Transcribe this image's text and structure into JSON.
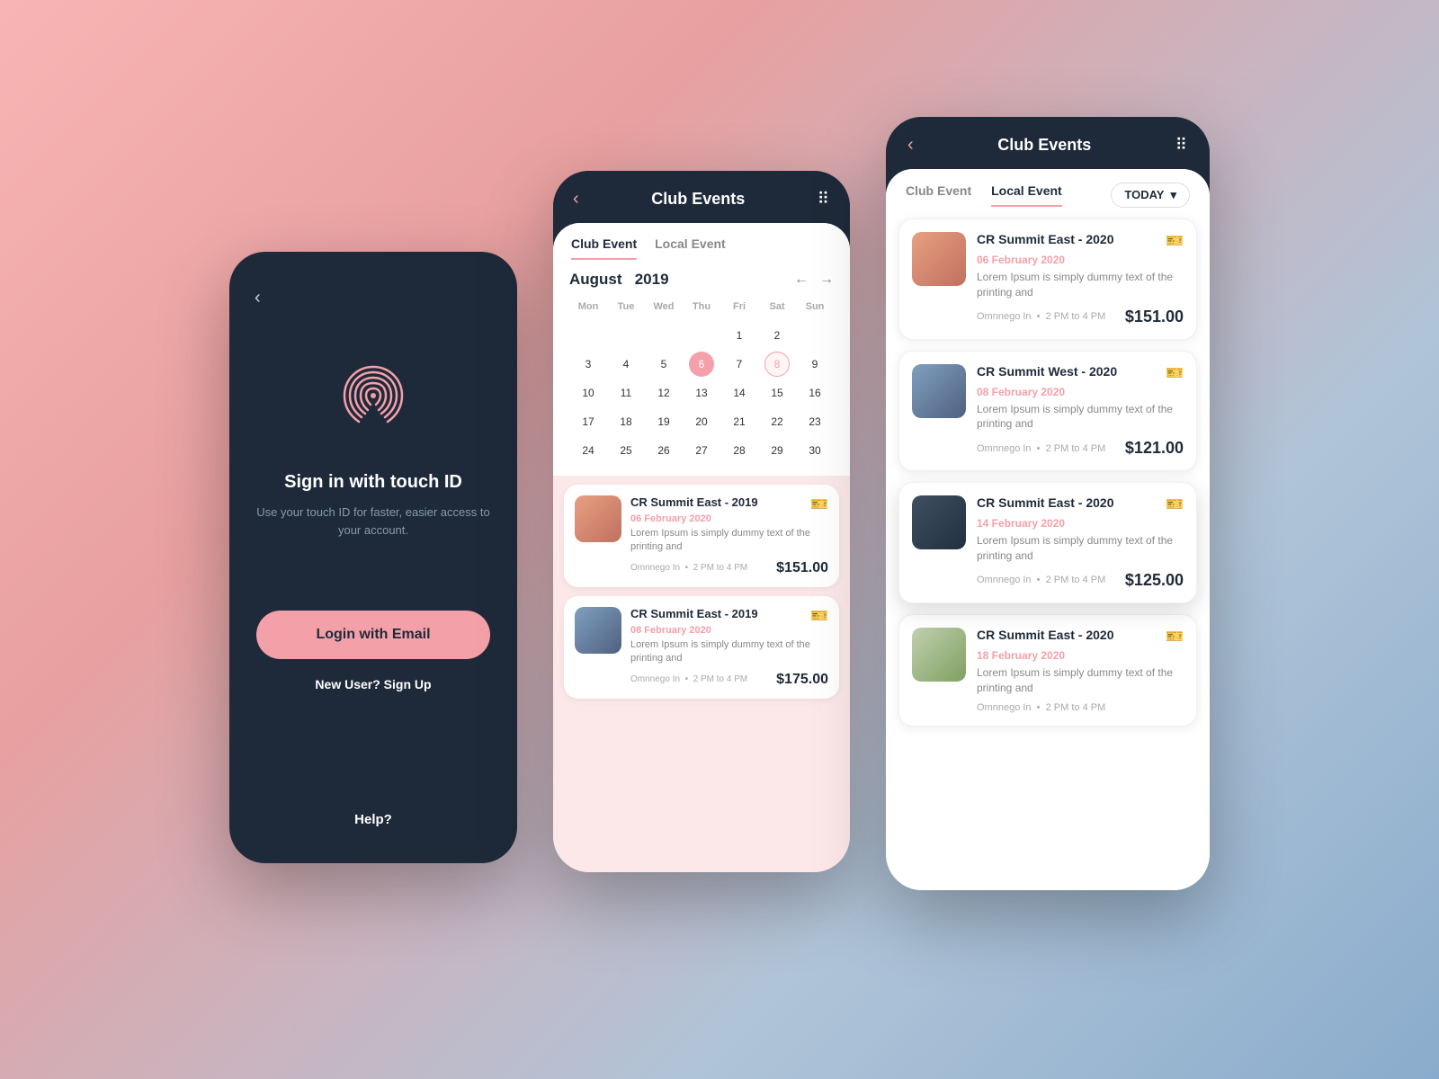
{
  "background": {
    "gradient_start": "#f8b4b4",
    "gradient_end": "#8aaccc"
  },
  "phone1": {
    "back_arrow": "‹",
    "fingerprint_label": "fingerprint",
    "title": "Sign in with touch ID",
    "subtitle": "Use your touch ID for faster, easier access to your account.",
    "login_button": "Login with Email",
    "new_user_text": "New User? Sign Up",
    "help_text": "Help?"
  },
  "phone2": {
    "header": {
      "back": "‹",
      "title": "Club Events",
      "dots": "⋮⋮"
    },
    "tabs": [
      {
        "label": "Club Event",
        "active": true
      },
      {
        "label": "Local Event",
        "active": false
      }
    ],
    "calendar": {
      "month": "August",
      "year": "2019",
      "days_header": [
        "Mon",
        "Tue",
        "Wed",
        "Thu",
        "Fri",
        "Sat",
        "Sun"
      ],
      "days": [
        "",
        "",
        "",
        "",
        "1",
        "2",
        "",
        "3",
        "4",
        "5",
        "6",
        "7",
        "8",
        "9",
        "10",
        "11",
        "12",
        "13",
        "14",
        "15",
        "16",
        "17",
        "18",
        "19",
        "20",
        "21",
        "22",
        "23",
        "24",
        "25",
        "26",
        "27",
        "28",
        "29",
        "30"
      ],
      "highlighted_pink": [
        "6"
      ],
      "highlighted_outline": [
        "8"
      ]
    },
    "events": [
      {
        "title": "CR Summit East - 2019",
        "date": "06 February 2020",
        "description": "Lorem Ipsum is simply dummy text of the printing and",
        "meta": "Omnnego In  •  2 PM to 4 PM",
        "price": "$151.00",
        "img_class": "img-crowd1"
      },
      {
        "title": "CR Summit East - 2019",
        "date": "08 February 2020",
        "description": "Lorem Ipsum is simply dummy text of the printing and",
        "meta": "Omnnego In  •  2 PM to 4 PM",
        "price": "$175.00",
        "img_class": "img-crowd2"
      }
    ]
  },
  "phone3": {
    "header": {
      "back": "‹",
      "title": "Club Events",
      "dots": "⋮⋮"
    },
    "tabs": [
      {
        "label": "Club Event",
        "active": false
      },
      {
        "label": "Local Event",
        "active": true
      }
    ],
    "today_btn": "TODAY",
    "events": [
      {
        "title": "CR Summit East - 2020",
        "date": "06 February 2020",
        "description": "Lorem Ipsum is simply dummy text of the printing and",
        "meta": "Omnnego In  •  2 PM to 4 PM",
        "price": "$151.00",
        "img_class": "img-crowd1",
        "elevated": false
      },
      {
        "title": "CR Summit West - 2020",
        "date": "08 February 2020",
        "description": "Lorem Ipsum is simply dummy text of the printing and",
        "meta": "Omnnego In  •  2 PM to 4 PM",
        "price": "$121.00",
        "img_class": "img-crowd2",
        "elevated": false
      },
      {
        "title": "CR Summit East - 2020",
        "date": "14 February 2020",
        "description": "Lorem Ipsum is simply dummy text of the printing and",
        "meta": "Omnnego In  •  2 PM to 4 PM",
        "price": "$125.00",
        "img_class": "img-crowd3",
        "elevated": true
      },
      {
        "title": "CR Summit East - 2020",
        "date": "18 February 2020",
        "description": "Lorem Ipsum is simply dummy text of the printing and",
        "meta": "Omnnego In  •  2 PM to 4 PM",
        "price": "",
        "img_class": "img-crowd4",
        "elevated": false
      }
    ]
  }
}
